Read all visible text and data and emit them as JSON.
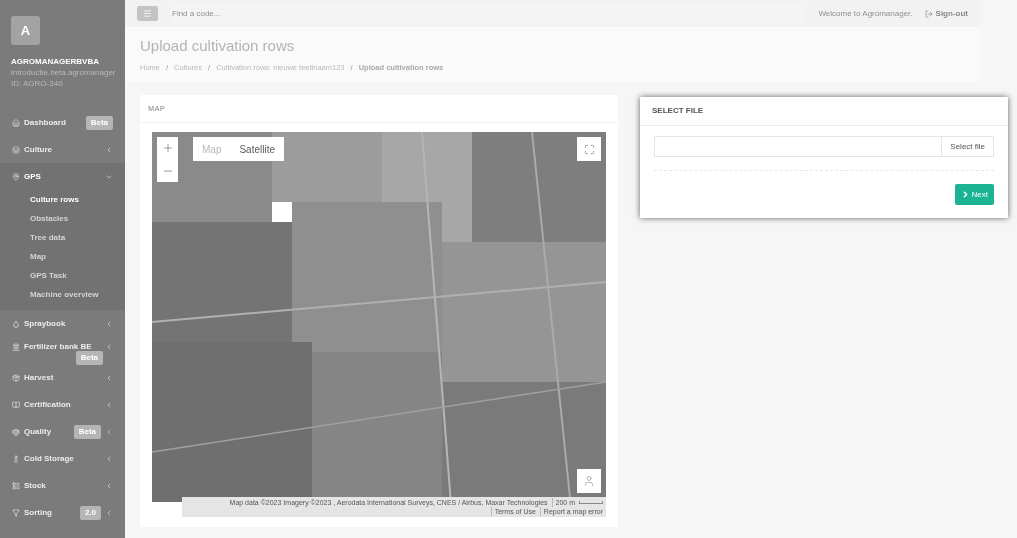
{
  "sidebar": {
    "avatar": "A",
    "company": "AGROMANAGERBVBA",
    "domain": "introductie.beta.agromanager",
    "account_id": "ID: AGRO-340",
    "items": [
      {
        "label": "Dashboard",
        "badge": "Beta",
        "badge_below": false,
        "has_chevron": false,
        "expanded": false
      },
      {
        "label": "Culture",
        "has_chevron": true,
        "expanded": false
      },
      {
        "label": "GPS",
        "has_chevron": true,
        "expanded": true,
        "children": [
          {
            "label": "Culture rows",
            "selected": true
          },
          {
            "label": "Obstacles",
            "selected": false
          },
          {
            "label": "Tree data",
            "selected": false
          },
          {
            "label": "Map",
            "selected": false
          },
          {
            "label": "GPS Task",
            "selected": false
          },
          {
            "label": "Machine overview",
            "selected": false
          }
        ]
      },
      {
        "label": "Spraybook",
        "has_chevron": true,
        "expanded": false
      },
      {
        "label": "Fertilizer bank BE",
        "badge": "Beta",
        "badge_below": true,
        "has_chevron": true,
        "expanded": false
      },
      {
        "label": "Harvest",
        "has_chevron": true,
        "expanded": false
      },
      {
        "label": "Certification",
        "has_chevron": true,
        "expanded": false
      },
      {
        "label": "Quality",
        "badge": "Beta",
        "badge_below": false,
        "has_chevron": true,
        "expanded": false
      },
      {
        "label": "Cold Storage",
        "has_chevron": true,
        "expanded": false
      },
      {
        "label": "Stock",
        "has_chevron": true,
        "expanded": false
      },
      {
        "label": "Sorting",
        "badge": "2.0",
        "badge_below": false,
        "has_chevron": true,
        "expanded": false
      }
    ]
  },
  "topbar": {
    "search": {
      "placeholder": "Find a code..."
    },
    "welcome": "Welcome to Agromanager.",
    "sign_out": "Sign-out"
  },
  "page": {
    "title": "Upload cultivation rows",
    "breadcrumb_separator": "/",
    "breadcrumb": [
      "Home",
      "Cultures",
      "Cultivation rows: nieuwe teeltnaam123",
      "Upload cultivation rows"
    ]
  },
  "map_card": {
    "title": "MAP",
    "map_types": [
      {
        "label": "Map",
        "selected": false
      },
      {
        "label": "Satellite",
        "selected": true
      }
    ],
    "attribution": [
      "Map data ©2023 Imagery ©2023 , Aerodata International Surveys, CNES / Airbus, Maxar Technologies",
      "200 m",
      "Terms of Use",
      "Report a map error"
    ]
  },
  "file_card": {
    "title": "SELECT FILE",
    "select_button": "Select file",
    "next_button": "Next"
  }
}
